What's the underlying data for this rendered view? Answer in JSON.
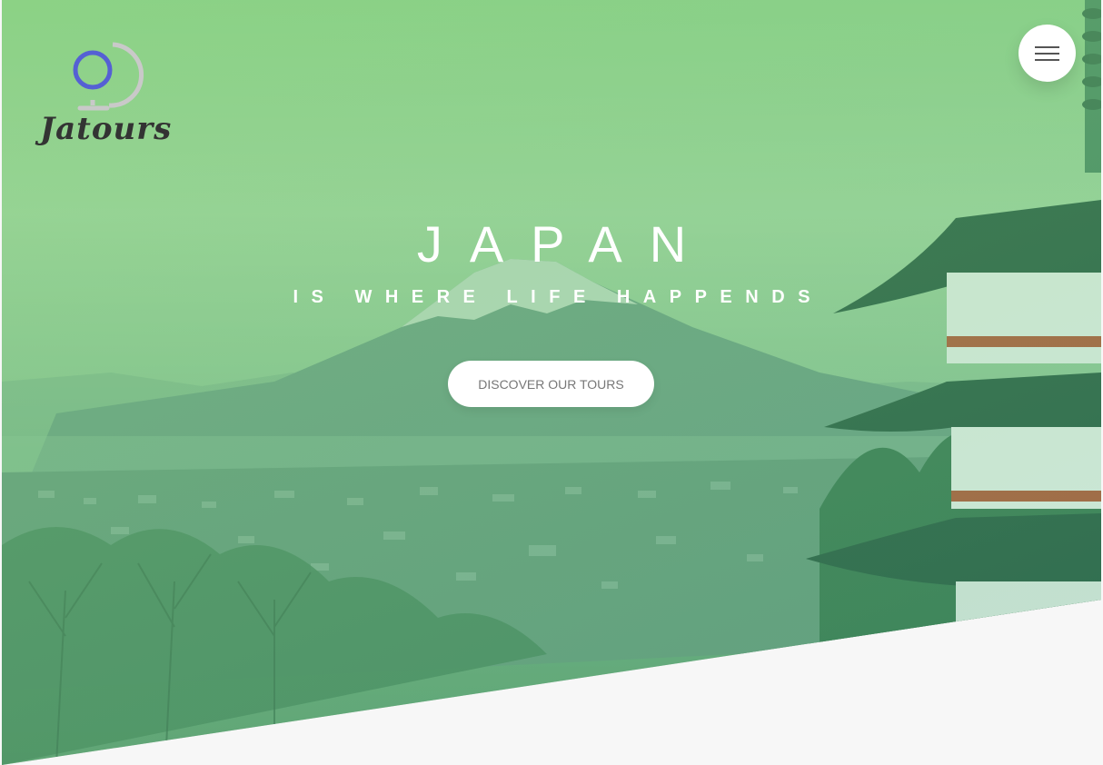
{
  "brand": {
    "name": "Jatours",
    "icon": "globe-icon"
  },
  "nav": {
    "menu_icon": "hamburger-menu-icon"
  },
  "hero": {
    "title": "JAPAN",
    "subtitle": "IS WHERE LIFE HAPPENDS",
    "cta_label": "DISCOVER OUR TOURS"
  },
  "colors": {
    "gradient_start": "#7ed56f",
    "gradient_end": "#28b485",
    "logo_globe": "#5560d4",
    "text_light": "#ffffff",
    "button_text": "#777777",
    "page_background": "#f7f7f7"
  }
}
